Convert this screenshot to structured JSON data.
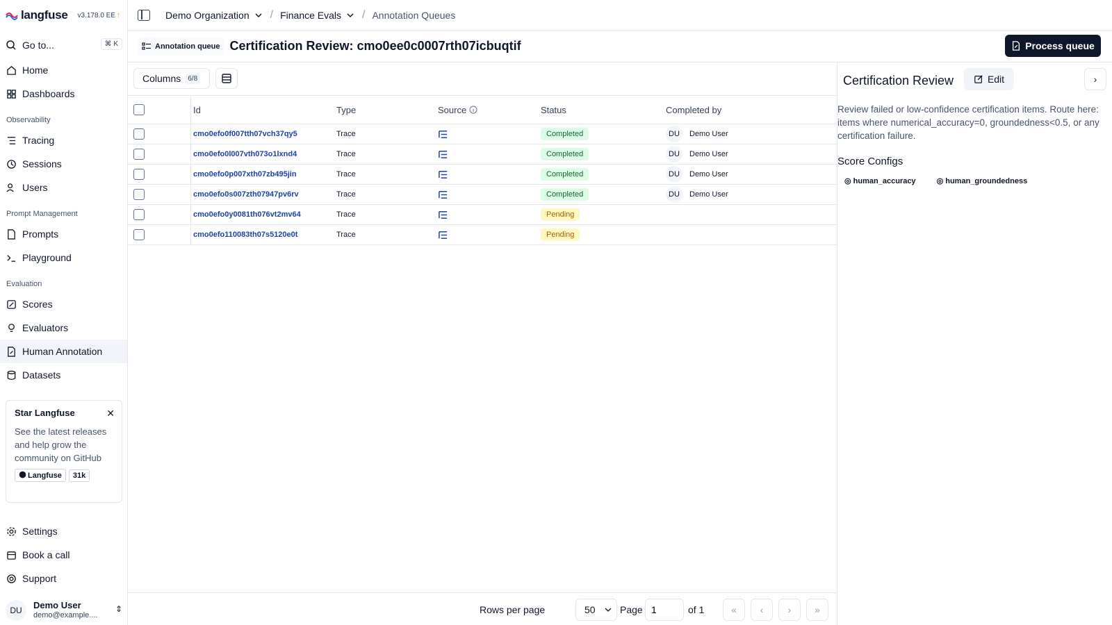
{
  "brand": {
    "name": "langfuse",
    "version": "v3.178.0 EE",
    "update_icon": "arrow-up-icon"
  },
  "search": {
    "label": "Go to...",
    "shortcut": "⌘ K"
  },
  "nav": {
    "home": "Home",
    "dashboards": "Dashboards",
    "section_observability": "Observability",
    "tracing": "Tracing",
    "sessions": "Sessions",
    "users": "Users",
    "section_prompt": "Prompt Management",
    "prompts": "Prompts",
    "playground": "Playground",
    "section_evaluation": "Evaluation",
    "scores": "Scores",
    "evaluators": "Evaluators",
    "human_annotation": "Human Annotation",
    "datasets": "Datasets",
    "settings": "Settings",
    "book_call": "Book a call",
    "support": "Support"
  },
  "star": {
    "title": "Star Langfuse",
    "desc": "See the latest releases and help grow the community on GitHub",
    "repo": "Langfuse",
    "stars": "31k"
  },
  "user": {
    "initials": "DU",
    "name": "Demo User",
    "email": "demo@example...."
  },
  "breadcrumb": {
    "org": "Demo Organization",
    "project": "Finance Evals",
    "page": "Annotation Queues"
  },
  "header": {
    "badge": "Annotation queue",
    "title": "Certification Review: cmo0ee0c0007rth07icbuqtif",
    "process_label": "Process queue"
  },
  "toolbar": {
    "columns_label": "Columns",
    "columns_count": "6/8"
  },
  "table": {
    "headers": {
      "id": "Id",
      "type": "Type",
      "source": "Source",
      "status": "Status",
      "completed_by": "Completed by"
    },
    "rows": [
      {
        "id": "cmo0efo0f007tth07vch37qy5",
        "type": "Trace",
        "status": "Completed",
        "user_initials": "DU",
        "user": "Demo User"
      },
      {
        "id": "cmo0efo0l007vth073o1lxnd4",
        "type": "Trace",
        "status": "Completed",
        "user_initials": "DU",
        "user": "Demo User"
      },
      {
        "id": "cmo0efo0p007xth07zb495jin",
        "type": "Trace",
        "status": "Completed",
        "user_initials": "DU",
        "user": "Demo User"
      },
      {
        "id": "cmo0efo0s007zth07947pv6rv",
        "type": "Trace",
        "status": "Completed",
        "user_initials": "DU",
        "user": "Demo User"
      },
      {
        "id": "cmo0efo0y0081th076vt2mv64",
        "type": "Trace",
        "status": "Pending",
        "user_initials": "",
        "user": ""
      },
      {
        "id": "cmo0efo110083th07s5120e0t",
        "type": "Trace",
        "status": "Pending",
        "user_initials": "",
        "user": ""
      }
    ]
  },
  "footer": {
    "rows_per_page_label": "Rows per page",
    "rows_per_page": "50",
    "page_label": "Page",
    "page": "1",
    "of_label": "of 1"
  },
  "panel": {
    "title": "Certification Review",
    "edit_label": "Edit",
    "description": "Review failed or low-confidence certification items. Route here: items where numerical_accuracy=0, groundedness<0.5, or any certification failure.",
    "score_configs_title": "Score Configs",
    "score_configs": [
      "human_accuracy",
      "human_groundedness"
    ]
  },
  "colors": {
    "accent": "#0f172a",
    "link": "#1e40af",
    "completed_bg": "#dcfce7",
    "pending_bg": "#fef9c3"
  }
}
